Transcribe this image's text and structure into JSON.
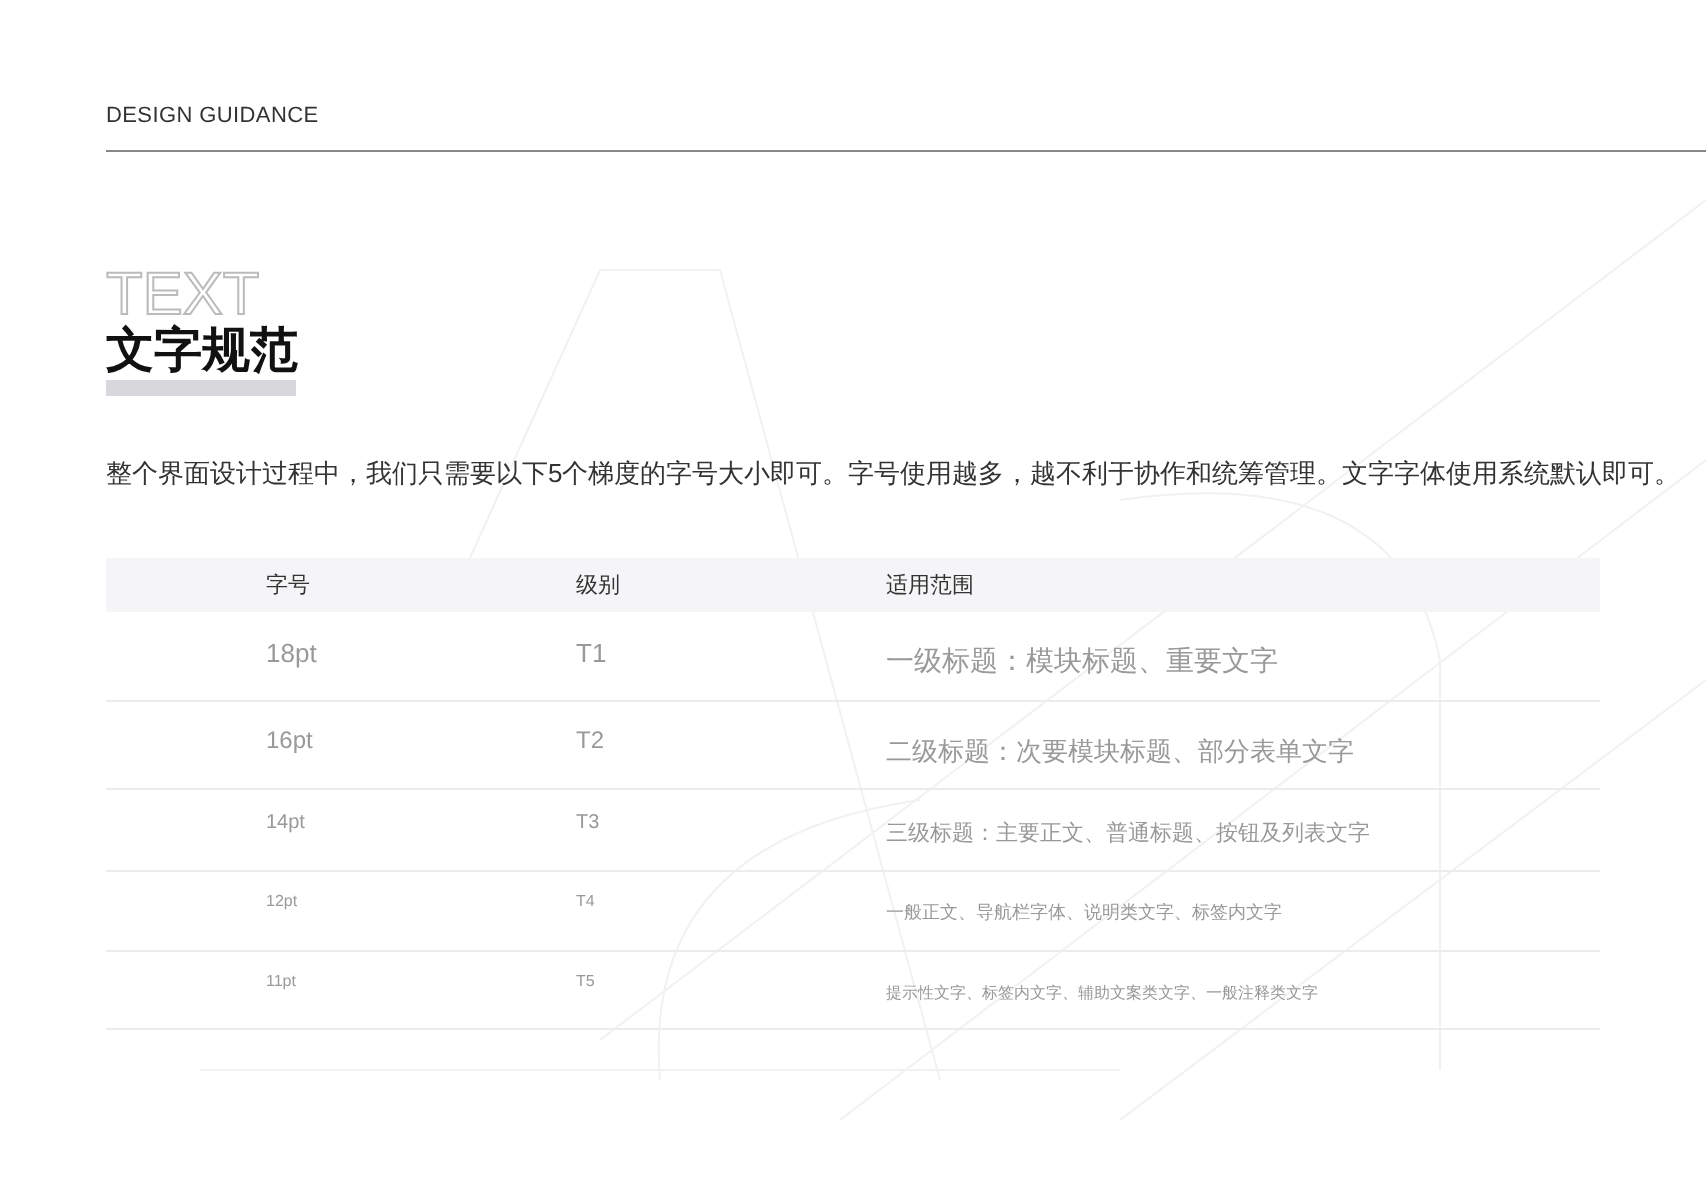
{
  "header": {
    "label": "DESIGN GUIDANCE"
  },
  "title": {
    "backdrop": "TEXT",
    "text": "文字规范"
  },
  "description": "整个界面设计过程中，我们只需要以下5个梯度的字号大小即可。字号使用越多，越不利于协作和统筹管理。文字字体使用系统默认即可。",
  "table": {
    "columns": [
      "字号",
      "级别",
      "适用范围"
    ],
    "rows": [
      [
        "18pt",
        "T1",
        "一级标题：模块标题、重要文字"
      ],
      [
        "16pt",
        "T2",
        "二级标题：次要模块标题、部分表单文字"
      ],
      [
        "14pt",
        "T3",
        "三级标题：主要正文、普通标题、按钮及列表文字"
      ],
      [
        "12pt",
        "T4",
        "一般正文、导航栏字体、说明类文字、标签内文字"
      ],
      [
        "11pt",
        "T5",
        "提示性文字、标签内文字、辅助文案类文字、一般注释类文字"
      ]
    ]
  }
}
